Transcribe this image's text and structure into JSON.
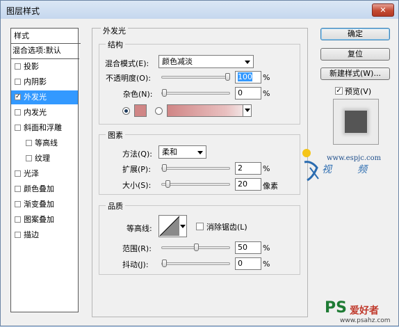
{
  "window": {
    "title": "图层样式"
  },
  "list": {
    "header": "样式",
    "blend": "混合选项:默认",
    "items": [
      {
        "label": "投影",
        "checked": false,
        "selected": false
      },
      {
        "label": "内阴影",
        "checked": false,
        "selected": false
      },
      {
        "label": "外发光",
        "checked": true,
        "selected": true
      },
      {
        "label": "内发光",
        "checked": false,
        "selected": false
      },
      {
        "label": "斜面和浮雕",
        "checked": false,
        "selected": false
      },
      {
        "label": "等高线",
        "checked": false,
        "selected": false
      },
      {
        "label": "纹理",
        "checked": false,
        "selected": false
      },
      {
        "label": "光泽",
        "checked": false,
        "selected": false
      },
      {
        "label": "颜色叠加",
        "checked": false,
        "selected": false
      },
      {
        "label": "渐变叠加",
        "checked": false,
        "selected": false
      },
      {
        "label": "图案叠加",
        "checked": false,
        "selected": false
      },
      {
        "label": "描边",
        "checked": false,
        "selected": false
      }
    ]
  },
  "buttons": {
    "ok": "确定",
    "reset": "复位",
    "new_style": "新建样式(W)...",
    "preview": "预览(V)",
    "preview_checked": true,
    "checkmark": "✓"
  },
  "panel": {
    "title": "外发光",
    "structure": {
      "legend": "结构",
      "blend_mode_label": "混合模式(E):",
      "blend_mode_value": "颜色减淡",
      "opacity_label": "不透明度(O):",
      "opacity_value": "100",
      "opacity_unit": "%",
      "noise_label": "杂色(N):",
      "noise_value": "0",
      "noise_unit": "%",
      "color_radio_selected": true,
      "color_swatch": "#d08686"
    },
    "elements": {
      "legend": "图素",
      "method_label": "方法(Q):",
      "method_value": "柔和",
      "spread_label": "扩展(P):",
      "spread_value": "2",
      "spread_unit": "%",
      "size_label": "大小(S):",
      "size_value": "20",
      "size_unit": "像素"
    },
    "quality": {
      "legend": "品质",
      "contour_label": "等高线:",
      "antialias_label": "消除锯齿(L)",
      "range_label": "范围(R):",
      "range_value": "50",
      "range_unit": "%",
      "jitter_label": "抖动(J):",
      "jitter_value": "0",
      "jitter_unit": "%"
    }
  },
  "sliders": {
    "opacity": 1.0,
    "noise": 0.0,
    "spread": 0.02,
    "size": 0.08,
    "range": 0.5,
    "jitter": 0.0
  },
  "watermarks": {
    "site": "www.espjc.com",
    "cn1": "视",
    "cn2": "频",
    "ps_brand": "PS",
    "ps_cn": "爱好者",
    "ps_url": "www.psahz.com"
  },
  "colors": {
    "selection": "#3399ff",
    "glow": "#d08686"
  }
}
